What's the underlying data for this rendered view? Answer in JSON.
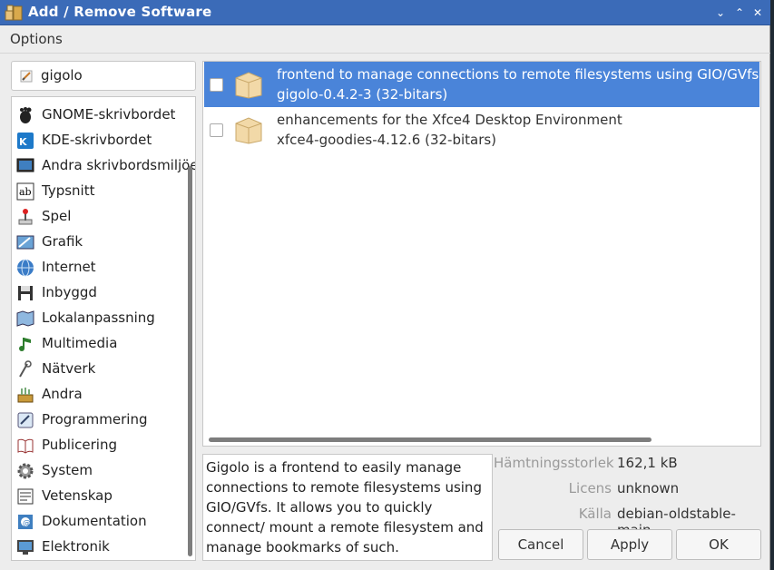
{
  "window": {
    "title": "Add / Remove Software"
  },
  "titlebar": {
    "buttons": [
      "⌄",
      "⌃",
      "✕"
    ]
  },
  "menu": {
    "options_label": "Options"
  },
  "search": {
    "value": "gigolo"
  },
  "categories": [
    {
      "label": "GNOME-skrivbordet",
      "icon": "gnome-icon"
    },
    {
      "label": "KDE-skrivbordet",
      "icon": "kde-icon"
    },
    {
      "label": "Andra skrivbordsmiljöer",
      "icon": "desktop-icon"
    },
    {
      "label": "Typsnitt",
      "icon": "font-icon"
    },
    {
      "label": "Spel",
      "icon": "joystick-icon"
    },
    {
      "label": "Grafik",
      "icon": "graphics-icon"
    },
    {
      "label": "Internet",
      "icon": "globe-icon"
    },
    {
      "label": "Inbyggd",
      "icon": "floppy-icon"
    },
    {
      "label": "Lokalanpassning",
      "icon": "map-icon"
    },
    {
      "label": "Multimedia",
      "icon": "music-icon"
    },
    {
      "label": "Nätverk",
      "icon": "network-icon"
    },
    {
      "label": "Andra",
      "icon": "tools-icon"
    },
    {
      "label": "Programmering",
      "icon": "programming-icon"
    },
    {
      "label": "Publicering",
      "icon": "book-icon"
    },
    {
      "label": "System",
      "icon": "gear-icon"
    },
    {
      "label": "Vetenskap",
      "icon": "science-icon"
    },
    {
      "label": "Dokumentation",
      "icon": "documentation-icon"
    },
    {
      "label": "Elektronik",
      "icon": "monitor-icon"
    }
  ],
  "packages": [
    {
      "summary": "frontend to manage connections to remote filesystems using GIO/GVfs",
      "name": "gigolo-0.4.2-3 (32-bitars)",
      "selected": true,
      "checked": false
    },
    {
      "summary": "enhancements for the Xfce4 Desktop Environment",
      "name": "xfce4-goodies-4.12.6 (32-bitars)",
      "selected": false,
      "checked": false
    }
  ],
  "description": "Gigolo is a frontend to easily manage connections to remote filesystems using GIO/GVfs. It allows you to quickly connect/ mount a remote filesystem and manage bookmarks of such.",
  "details": {
    "download_size_label": "Hämtningsstorlek",
    "download_size_value": "162,1 kB",
    "license_label": "Licens",
    "license_value": "unknown",
    "source_label": "Källa",
    "source_value": "debian-oldstable-main"
  },
  "buttons": {
    "cancel": "Cancel",
    "apply": "Apply",
    "ok": "OK"
  },
  "colors": {
    "titlebar": "#3b6bb8",
    "selection": "#4a84d9"
  }
}
